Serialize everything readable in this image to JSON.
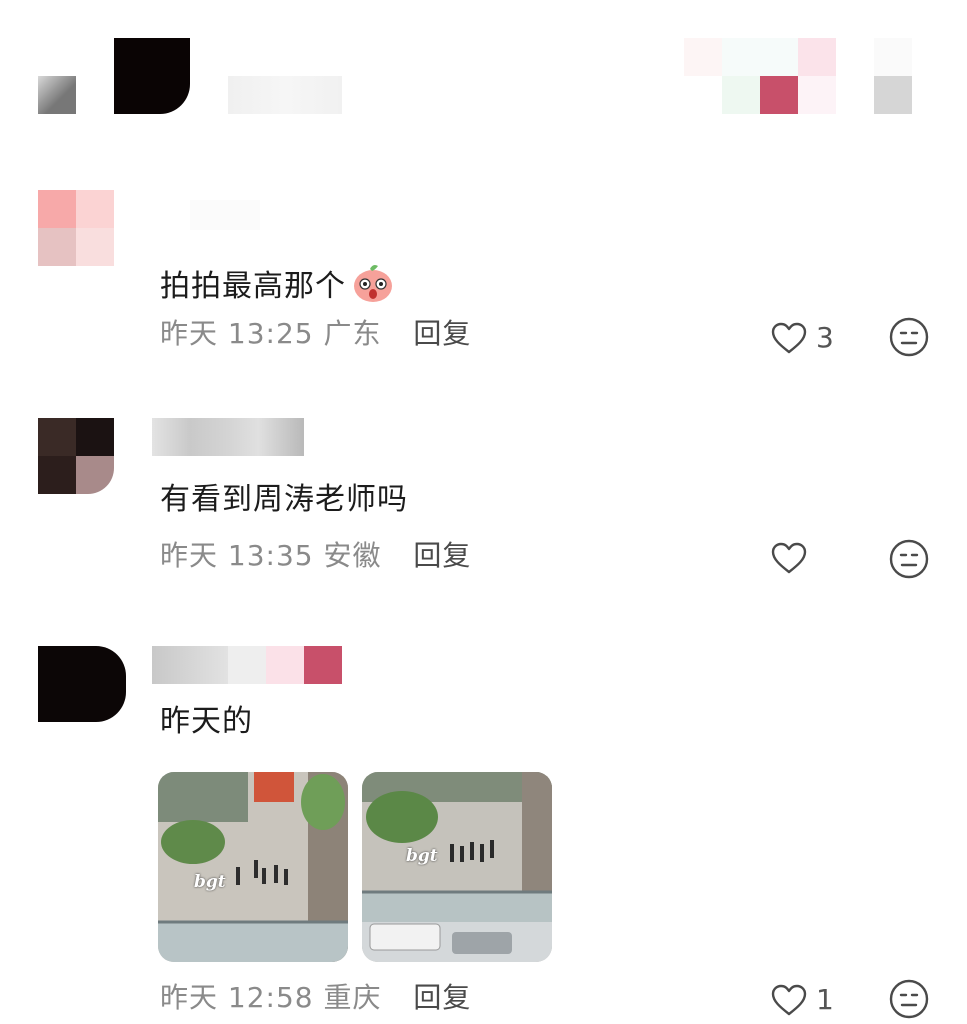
{
  "comments": [
    {
      "content": "拍拍最高那个",
      "emoji": "peach-surprised-emoji",
      "time": "昨天 13:25",
      "location": "广东",
      "reply_label": "回复",
      "likes": "3"
    },
    {
      "content": "有看到周涛老师吗",
      "time": "昨天 13:35",
      "location": "安徽",
      "reply_label": "回复",
      "likes": ""
    },
    {
      "content": "昨天的",
      "images": [
        {
          "watermark": "bgt"
        },
        {
          "watermark": "bgt"
        }
      ],
      "time": "昨天 12:58",
      "location": "重庆",
      "reply_label": "回复",
      "likes": "1"
    }
  ],
  "icons": {
    "like": "heart-outline-icon",
    "dislike": "meh-face-icon"
  },
  "colors": {
    "meta_text": "#8a8a8a",
    "pixelate_pink": "#c8506a"
  }
}
